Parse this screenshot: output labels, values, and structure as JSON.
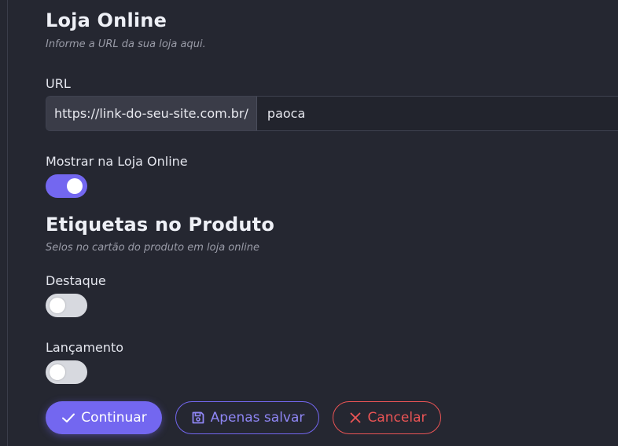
{
  "online_store": {
    "title": "Loja Online",
    "subtitle": "Informe a URL da sua loja aqui.",
    "url_label": "URL",
    "url_prefix": "https://link-do-seu-site.com.br/",
    "url_value": "paoca",
    "show_label": "Mostrar na Loja Online",
    "show_enabled": true
  },
  "product_tags": {
    "title": "Etiquetas no Produto",
    "subtitle": "Selos no cartão do produto em loja online",
    "items": [
      {
        "label": "Destaque",
        "enabled": false
      },
      {
        "label": "Lançamento",
        "enabled": false
      }
    ]
  },
  "actions": {
    "continue_label": "Continuar",
    "save_only_label": "Apenas salvar",
    "cancel_label": "Cancelar"
  },
  "colors": {
    "background": "#252731",
    "accent": "#7367f0",
    "danger": "#ea5455",
    "toggle_off": "#d7d9df"
  },
  "icons": {
    "continue": "check-icon",
    "save_only": "floppy-disk-icon",
    "cancel": "close-icon"
  }
}
